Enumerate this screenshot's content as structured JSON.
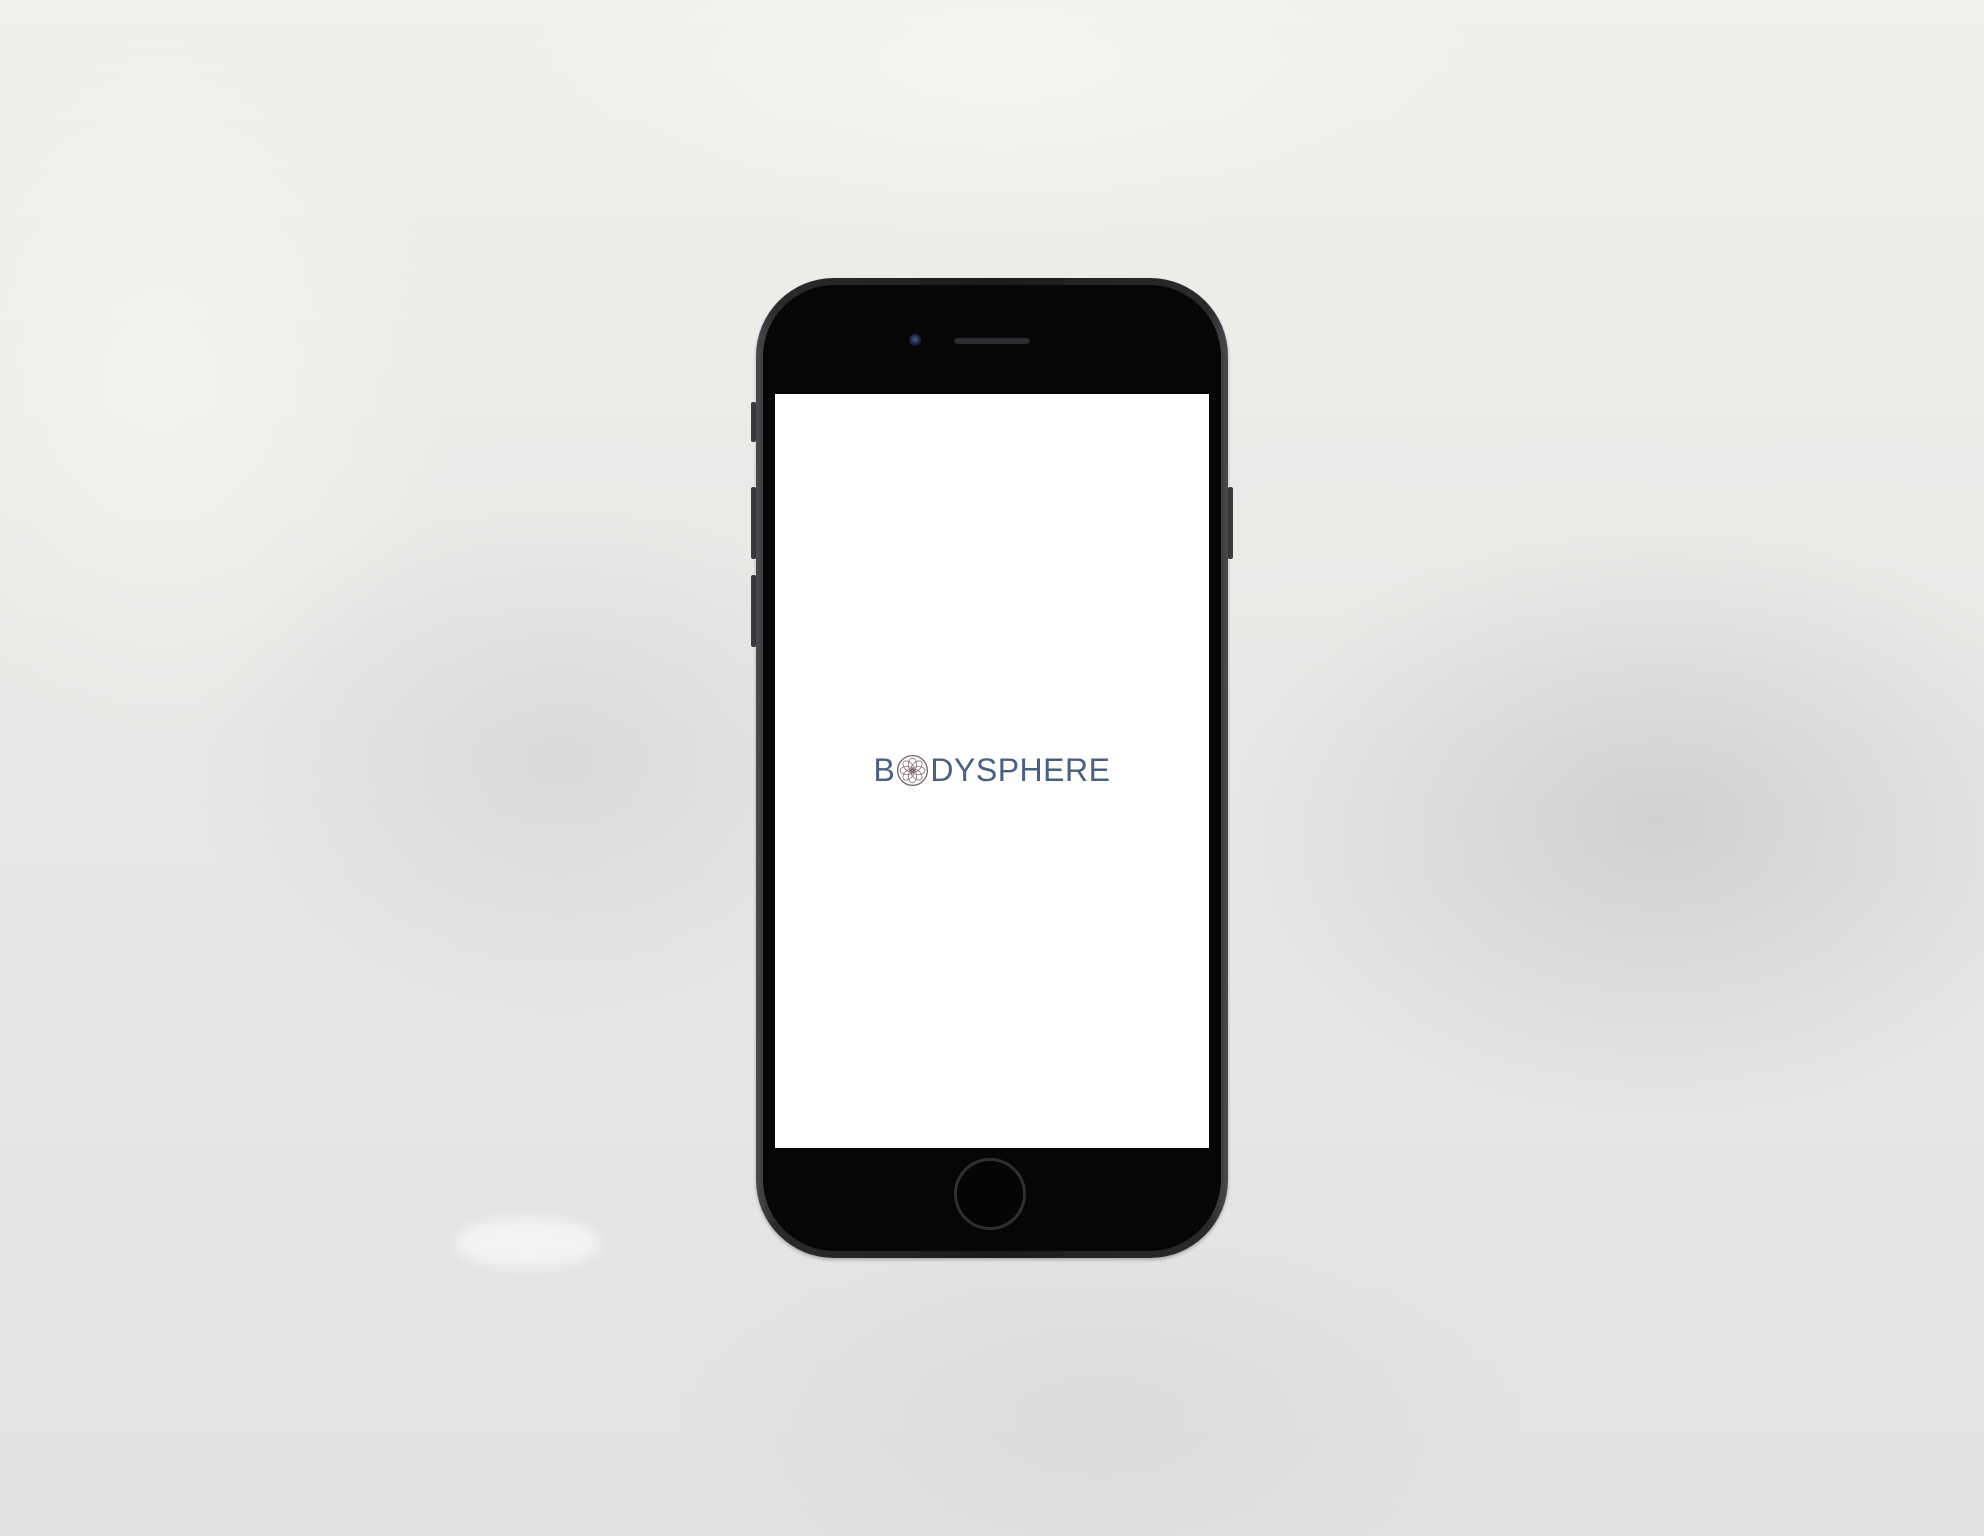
{
  "device": {
    "type": "iPhone mockup",
    "frame_color": "#1c1c1e"
  },
  "app": {
    "brand_prefix": "B",
    "brand_suffix": "DYSPHERE",
    "brand_color": "#4b5f80",
    "logo_icon": "mandala-flower-icon",
    "logo_color": "#8a6f78"
  }
}
